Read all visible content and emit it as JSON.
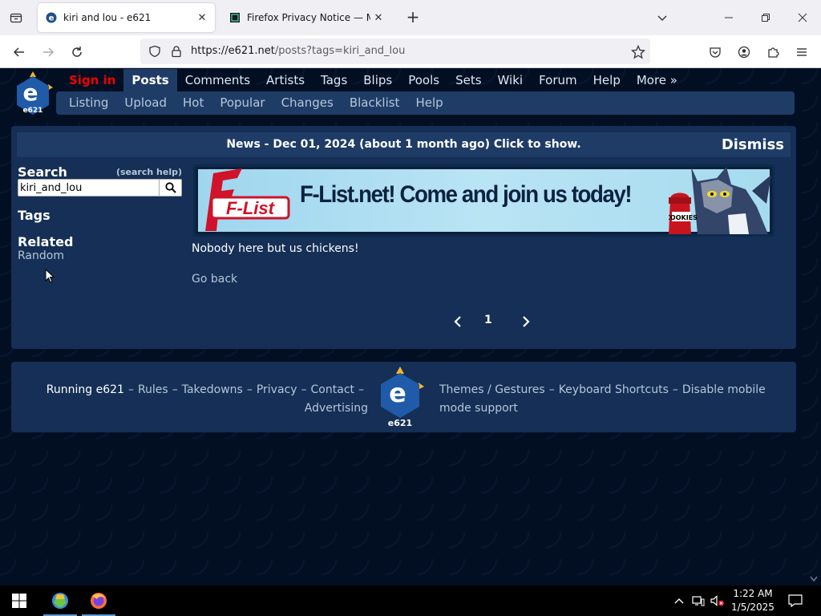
{
  "browser": {
    "tabs": [
      {
        "title": "kiri and lou - e621",
        "active": true
      },
      {
        "title": "Firefox Privacy Notice — Mozill",
        "active": false
      }
    ],
    "url_host": "https://e621.net",
    "url_path": "/posts?tags=kiri_and_lou"
  },
  "site": {
    "main_nav": [
      "Sign in",
      "Posts",
      "Comments",
      "Artists",
      "Tags",
      "Blips",
      "Pools",
      "Sets",
      "Wiki",
      "Forum",
      "Help",
      "More »"
    ],
    "sub_nav": [
      "Listing",
      "Upload",
      "Hot",
      "Popular",
      "Changes",
      "Blacklist",
      "Help"
    ],
    "news": {
      "text": "News - Dec 01, 2024 (about 1 month ago) Click to show.",
      "dismiss": "Dismiss"
    },
    "sidebar": {
      "search_label": "Search",
      "search_help": "(search help)",
      "search_value": "kiri_and_lou",
      "tags_label": "Tags",
      "related_label": "Related",
      "random_link": "Random"
    },
    "banner": {
      "logo_text": "F-List",
      "slogan": "F-List.net! Come and join us today!",
      "jar_label": "COOKIES"
    },
    "empty_message": "Nobody here but us chickens!",
    "go_back": "Go back",
    "pager": {
      "current_page": "1"
    },
    "logo_text": "e621",
    "footer": {
      "running": "Running e621",
      "links_left": [
        "Rules",
        "Takedowns",
        "Privacy",
        "Contact",
        "Advertising"
      ],
      "links_right": [
        "Themes / Gestures",
        "Keyboard Shortcuts",
        "Disable mobile mode support"
      ]
    }
  },
  "taskbar": {
    "time": "1:22 AM",
    "date": "1/5/2025"
  },
  "colors": {
    "page_bg": "#020f23",
    "panel_bg": "#152f56",
    "nav_highlight": "#1f3c67",
    "link": "#b4c7d9",
    "sign_in": "#ee0000"
  }
}
